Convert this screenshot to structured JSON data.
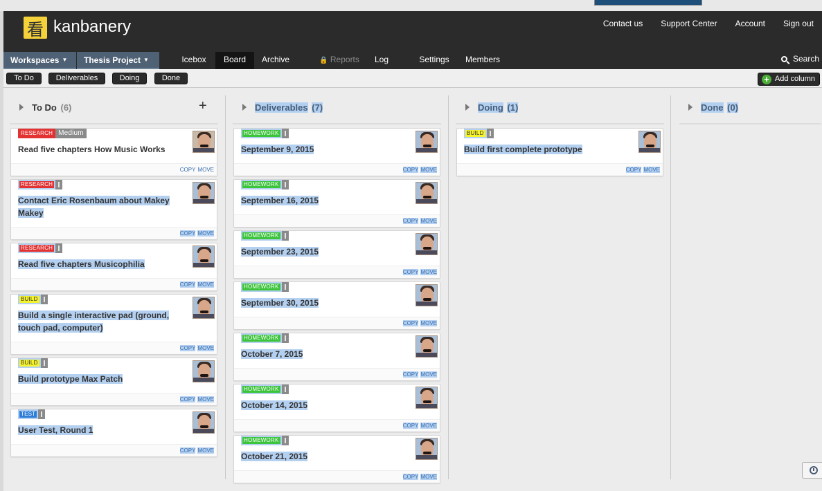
{
  "header": {
    "logo_glyph": "看",
    "brand": "kanbanery",
    "links": [
      "Contact us",
      "Support Center",
      "Account",
      "Sign out"
    ]
  },
  "nav": {
    "workspaces": "Workspaces",
    "project": "Thesis Project",
    "tabs": [
      "Icebox",
      "Board",
      "Archive",
      "Reports",
      "Log",
      "Settings",
      "Members"
    ],
    "active_tab": "Board",
    "search": "Search"
  },
  "column_buttons": [
    "To Do",
    "Deliverables",
    "Doing",
    "Done"
  ],
  "add_column": "Add column",
  "columns": [
    {
      "title": "To Do",
      "count": "(6)",
      "cards": [
        {
          "tags": [
            "RESEARCH"
          ],
          "priority": "Medium",
          "title": "Read five chapters How Music Works"
        },
        {
          "tags": [
            "RESEARCH"
          ],
          "title": "Contact Eric Rosenbaum about Makey Makey"
        },
        {
          "tags": [
            "RESEARCH"
          ],
          "title": "Read five chapters Musicophilia"
        },
        {
          "tags": [
            "BUILD"
          ],
          "title": "Build a single interactive pad (ground, touch pad, computer)"
        },
        {
          "tags": [
            "BUILD"
          ],
          "title": "Build prototype Max Patch"
        },
        {
          "tags": [
            "TEST"
          ],
          "title": "User Test, Round 1"
        }
      ]
    },
    {
      "title": "Deliverables",
      "count": "(7)",
      "cards": [
        {
          "tags": [
            "HOMEWORK"
          ],
          "title": "September 9, 2015"
        },
        {
          "tags": [
            "HOMEWORK"
          ],
          "title": "September 16, 2015"
        },
        {
          "tags": [
            "HOMEWORK"
          ],
          "title": "September 23, 2015"
        },
        {
          "tags": [
            "HOMEWORK"
          ],
          "title": "September 30, 2015"
        },
        {
          "tags": [
            "HOMEWORK"
          ],
          "title": "October 7, 2015"
        },
        {
          "tags": [
            "HOMEWORK"
          ],
          "title": "October 14, 2015"
        },
        {
          "tags": [
            "HOMEWORK"
          ],
          "title": "October 21, 2015"
        }
      ]
    },
    {
      "title": "Doing",
      "count": "(1)",
      "cards": [
        {
          "tags": [
            "BUILD"
          ],
          "title": "Build first complete prototype"
        }
      ]
    },
    {
      "title": "Done",
      "count": "(0)",
      "cards": []
    }
  ],
  "card_actions": {
    "copy": "COPY",
    "move": "MOVE"
  },
  "colors": {
    "research": "#e33232",
    "build": "#f5f32c",
    "test": "#2e7ed8",
    "homework": "#3cc43b",
    "header": "#2b2b2b",
    "workspace_tab": "#4f6175"
  }
}
